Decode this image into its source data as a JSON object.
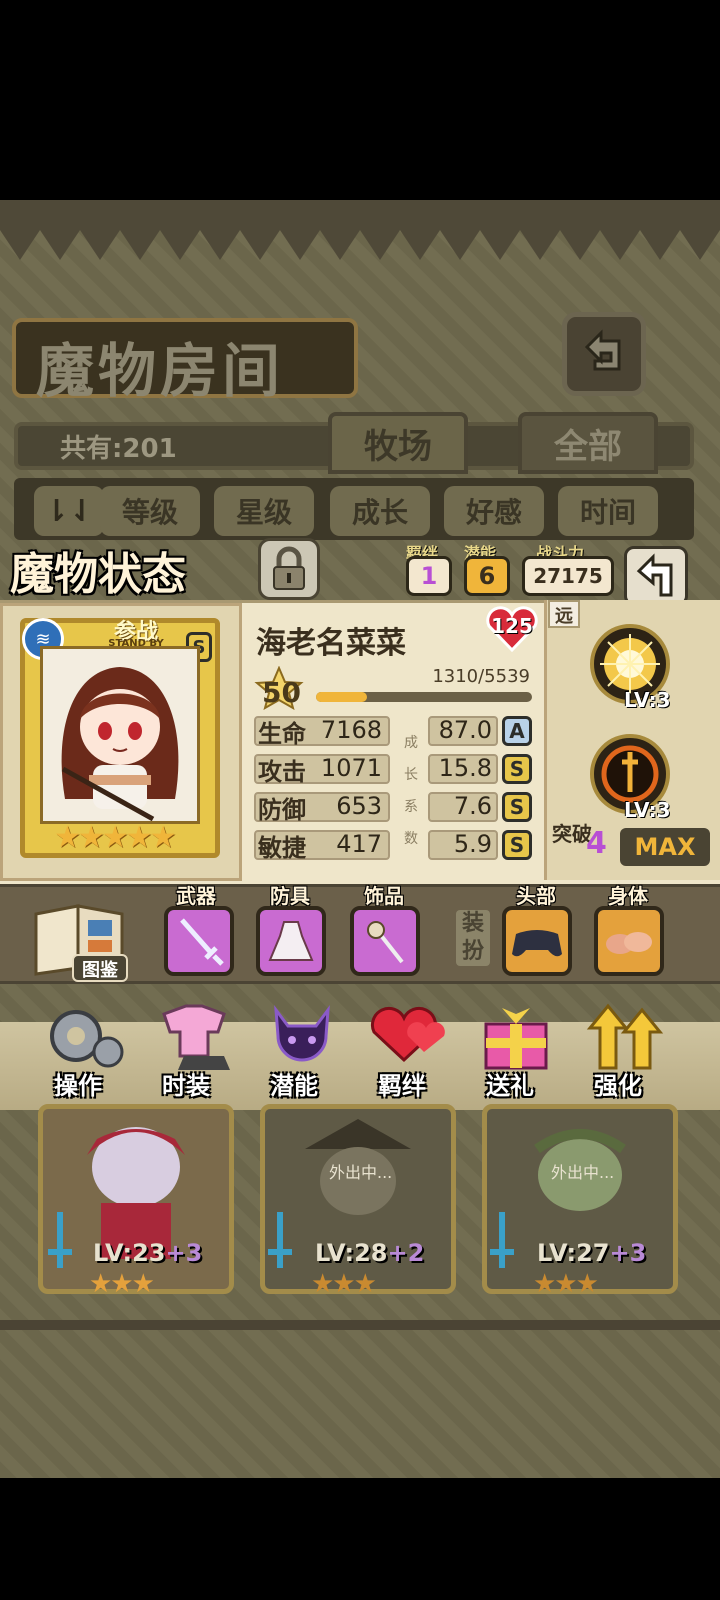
{
  "header": {
    "title": "魔物房间",
    "count": "共有:201"
  },
  "tabs": [
    {
      "label": "牧场"
    },
    {
      "label": "全部"
    }
  ],
  "sort_buttons": [
    {
      "label": "等级"
    },
    {
      "label": "星级"
    },
    {
      "label": "成长"
    },
    {
      "label": "好感"
    },
    {
      "label": "时间"
    }
  ],
  "status": {
    "title": "魔物状态",
    "bond": {
      "label": "羁绊",
      "value": "1"
    },
    "potential": {
      "label": "潜能",
      "value": "6"
    },
    "power": {
      "label": "战斗力",
      "value": "27175"
    }
  },
  "monster": {
    "name": "海老名菜菜",
    "affection": "125",
    "level": "50",
    "exp": "1310/5539",
    "exp_fraction": 0.2365,
    "standby_label": "参战",
    "standby_sub": "STAND BY",
    "rank_grade": "S",
    "stars": 5,
    "type_label": "远"
  },
  "stats": [
    {
      "label": "生命",
      "value": "7168",
      "growth": "87.0",
      "grade": "A"
    },
    {
      "label": "攻击",
      "value": "1071",
      "growth": "15.8",
      "grade": "S"
    },
    {
      "label": "防御",
      "value": "653",
      "growth": "7.6",
      "grade": "S"
    },
    {
      "label": "敏捷",
      "value": "417",
      "growth": "5.9",
      "grade": "S"
    }
  ],
  "growth_caption": [
    "成",
    "长",
    "系",
    "数"
  ],
  "skills": [
    {
      "level": "LV:3"
    },
    {
      "level": "LV:3"
    }
  ],
  "breakthrough": {
    "label": "突破",
    "value": "4",
    "max": "MAX"
  },
  "equipment": {
    "book_label": "图鉴",
    "slots": [
      {
        "label": "武器",
        "icon": "sword-icon"
      },
      {
        "label": "防具",
        "icon": "dress-icon"
      },
      {
        "label": "饰品",
        "icon": "wand-icon"
      }
    ],
    "dress_label": "装扮",
    "dress_slots": [
      {
        "label": "头部",
        "icon": "gamepad-icon"
      },
      {
        "label": "身体",
        "icon": "sausage-icon"
      }
    ]
  },
  "actions": [
    {
      "label": "操作",
      "icon": "gear-icon"
    },
    {
      "label": "时装",
      "icon": "outfit-icon"
    },
    {
      "label": "潜能",
      "icon": "demon-icon"
    },
    {
      "label": "羁绊",
      "icon": "hearts-icon"
    },
    {
      "label": "送礼",
      "icon": "gift-icon"
    },
    {
      "label": "强化",
      "icon": "upgrade-arrows-icon"
    }
  ],
  "list_cards": [
    {
      "level": "LV:23",
      "plus": "+3",
      "status": "",
      "stars": 3
    },
    {
      "level": "LV:28",
      "plus": "+2",
      "status": "外出中...",
      "stars": 3
    },
    {
      "level": "LV:27",
      "plus": "+3",
      "status": "外出中...",
      "stars": 3
    }
  ],
  "colors": {
    "accent_gold": "#f0b53a",
    "heart_red": "#d82b3a",
    "potential_purple": "#b84fd4",
    "slot_pink": "#c96bd1",
    "slot_orange": "#e4a13c"
  }
}
